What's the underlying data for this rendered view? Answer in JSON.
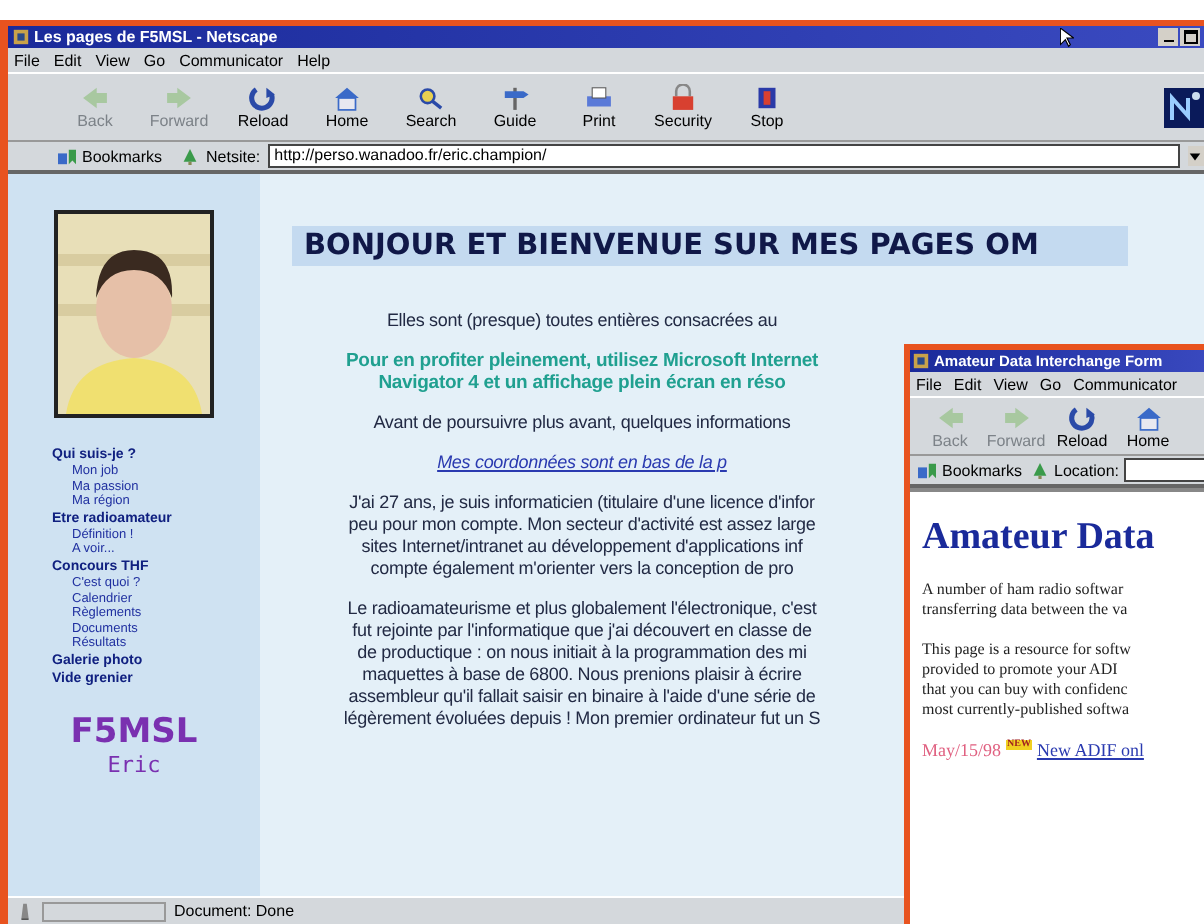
{
  "window": {
    "title": "Les pages de F5MSL - Netscape"
  },
  "menu": [
    "File",
    "Edit",
    "View",
    "Go",
    "Communicator",
    "Help"
  ],
  "toolbar": [
    {
      "label": "Back",
      "kind": "back",
      "disabled": true
    },
    {
      "label": "Forward",
      "kind": "forward",
      "disabled": true
    },
    {
      "label": "Reload",
      "kind": "reload",
      "disabled": false
    },
    {
      "label": "Home",
      "kind": "home",
      "disabled": false
    },
    {
      "label": "Search",
      "kind": "search",
      "disabled": false
    },
    {
      "label": "Guide",
      "kind": "guide",
      "disabled": false
    },
    {
      "label": "Print",
      "kind": "print",
      "disabled": false
    },
    {
      "label": "Security",
      "kind": "security",
      "disabled": false
    },
    {
      "label": "Stop",
      "kind": "stop",
      "disabled": false
    }
  ],
  "location": {
    "bookmarks": "Bookmarks",
    "label": "Netsite:",
    "url": "http://perso.wanadoo.fr/eric.champion/"
  },
  "sidebar": {
    "items": [
      {
        "label": "Qui suis-je ?",
        "children": [
          {
            "label": "Mon job"
          },
          {
            "label": "Ma passion"
          },
          {
            "label": "Ma région"
          }
        ]
      },
      {
        "label": "Etre radioamateur",
        "children": [
          {
            "label": "Définition !"
          },
          {
            "label": "A voir..."
          }
        ]
      },
      {
        "label": "Concours THF",
        "children": [
          {
            "label": "C'est quoi ?"
          },
          {
            "label": "Calendrier"
          },
          {
            "label": "Règlements"
          },
          {
            "label": "Documents"
          },
          {
            "label": "Résultats"
          }
        ]
      },
      {
        "label": "Galerie photo"
      },
      {
        "label": "Vide grenier"
      }
    ],
    "callsign": "F5MSL",
    "name": "Eric"
  },
  "page": {
    "heading": "BONJOUR ET BIENVENUE SUR MES PAGES OM",
    "blocks": [
      {
        "kind": "text",
        "text": "Elles sont (presque) toutes entières consacrées au"
      },
      {
        "kind": "notice",
        "text": "Pour en profiter pleinement, utilisez Microsoft Internet\nNavigator 4 et un affichage plein écran en réso"
      },
      {
        "kind": "text",
        "text": "Avant de poursuivre plus avant, quelques informations"
      },
      {
        "kind": "link",
        "text": "Mes coordonnées sont en bas de la p"
      },
      {
        "kind": "text",
        "text": "J'ai 27 ans, je suis informaticien (titulaire d'une licence d'infor\npeu pour mon compte. Mon secteur d'activité est assez large\nsites Internet/intranet  au développement d'applications inf\ncompte également m'orienter vers la conception de pro"
      },
      {
        "kind": "text",
        "text": "Le radioamateurisme et plus globalement l'électronique, c'est\nfut rejointe par l'informatique que j'ai découvert en classe de\nde productique : on nous initiait à la programmation des mi\nmaquettes à base de 6800. Nous prenions plaisir à écrire\nassembleur qu'il fallait saisir en binaire à l'aide d'une série de\nlégèrement évoluées depuis ! Mon premier ordinateur fut un S"
      }
    ]
  },
  "status_bar": "Document: Done",
  "second_window": {
    "title": "Amateur Data Interchange Form",
    "menu": [
      "File",
      "Edit",
      "View",
      "Go",
      "Communicator"
    ],
    "toolbar": [
      {
        "label": "Back",
        "kind": "back",
        "disabled": true
      },
      {
        "label": "Forward",
        "kind": "forward",
        "disabled": true
      },
      {
        "label": "Reload",
        "kind": "reload",
        "disabled": false
      },
      {
        "label": "Home",
        "kind": "home",
        "disabled": false
      }
    ],
    "bookmarks": "Bookmarks",
    "location_label": "Location:",
    "heading": "Amateur Data",
    "paragraphs": [
      "A number of ham radio softwar\ntransferring data between the va",
      "This page is a resource for softw\nprovided to promote your ADI\nthat you can buy with confidenc\nmost currently-published softwa"
    ],
    "news": {
      "date": "May/15/98",
      "badge": "NEW",
      "link": "New ADIF onl"
    }
  }
}
